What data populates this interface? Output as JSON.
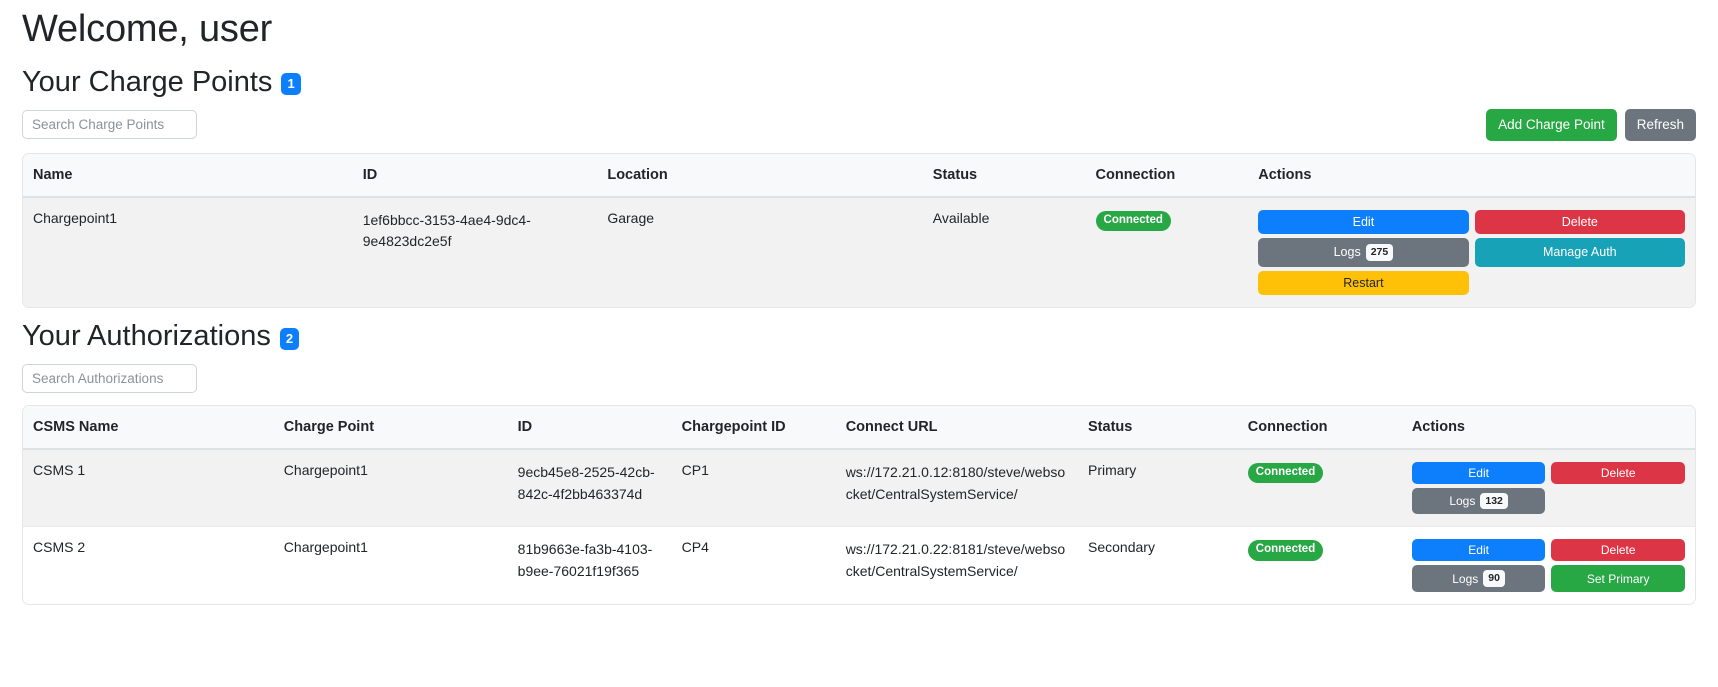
{
  "header": {
    "welcome": "Welcome, user"
  },
  "charge_points": {
    "title": "Your Charge Points",
    "count": "1",
    "search_placeholder": "Search Charge Points",
    "search_value": "",
    "add_label": "Add Charge Point",
    "refresh_label": "Refresh",
    "columns": [
      "Name",
      "ID",
      "Location",
      "Status",
      "Connection",
      "Actions"
    ],
    "rows": [
      {
        "name": "Chargepoint1",
        "id": "1ef6bbcc-3153-4ae4-9dc4-9e4823dc2e5f",
        "location": "Garage",
        "status": "Available",
        "connection": "Connected",
        "actions": {
          "edit": "Edit",
          "delete": "Delete",
          "logs": "Logs",
          "logs_count": "275",
          "manage_auth": "Manage Auth",
          "restart": "Restart"
        }
      }
    ]
  },
  "authorizations": {
    "title": "Your Authorizations",
    "count": "2",
    "search_placeholder": "Search Authorizations",
    "search_value": "",
    "columns": [
      "CSMS Name",
      "Charge Point",
      "ID",
      "Chargepoint ID",
      "Connect URL",
      "Status",
      "Connection",
      "Actions"
    ],
    "rows": [
      {
        "csms_name": "CSMS 1",
        "charge_point": "Chargepoint1",
        "id": "9ecb45e8-2525-42cb-842c-4f2bb463374d",
        "chargepoint_id": "CP1",
        "connect_url": "ws://172.21.0.12:8180/steve/websocket/CentralSystemService/",
        "status": "Primary",
        "connection": "Connected",
        "actions": {
          "edit": "Edit",
          "delete": "Delete",
          "logs": "Logs",
          "logs_count": "132",
          "set_primary": null
        }
      },
      {
        "csms_name": "CSMS 2",
        "charge_point": "Chargepoint1",
        "id": "81b9663e-fa3b-4103-b9ee-76021f19f365",
        "chargepoint_id": "CP4",
        "connect_url": "ws://172.21.0.22:8181/steve/websocket/CentralSystemService/",
        "status": "Secondary",
        "connection": "Connected",
        "actions": {
          "edit": "Edit",
          "delete": "Delete",
          "logs": "Logs",
          "logs_count": "90",
          "set_primary": "Set Primary"
        }
      }
    ]
  },
  "colors": {
    "accent_blue": "#0d7ffd",
    "success_green": "#28a745",
    "danger_red": "#dc3545",
    "neutral_gray": "#6c757d",
    "teal": "#17a2b8",
    "amber": "#ffc107"
  }
}
